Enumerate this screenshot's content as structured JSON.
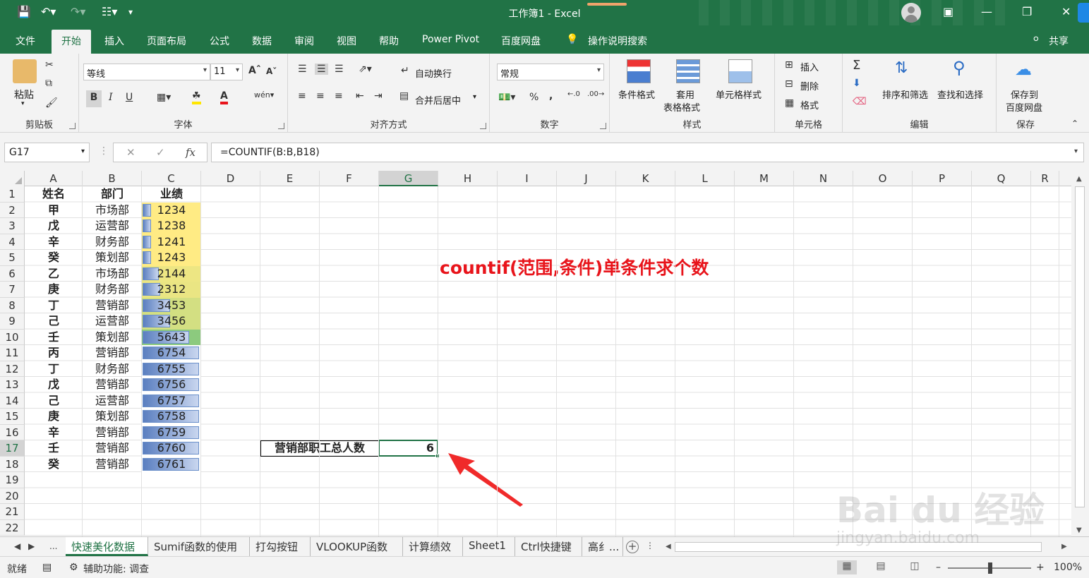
{
  "window": {
    "title": "工作簿1 - Excel",
    "share": "共享"
  },
  "ribbon_tabs": [
    "文件",
    "开始",
    "插入",
    "页面布局",
    "公式",
    "数据",
    "审阅",
    "视图",
    "帮助",
    "Power Pivot",
    "百度网盘",
    "操作说明搜索"
  ],
  "active_tab": "开始",
  "ribbon": {
    "clipboard": {
      "paste": "粘贴",
      "group": "剪贴板"
    },
    "font": {
      "name": "等线",
      "size": "11",
      "bold": "B",
      "italic": "I",
      "underline": "U",
      "group": "字体"
    },
    "alignment": {
      "wrap": "自动换行",
      "merge": "合并后居中",
      "group": "对齐方式"
    },
    "number": {
      "format": "常规",
      "percent": "%",
      "comma": ",",
      "group": "数字"
    },
    "styles": {
      "cond": "条件格式",
      "table1": "套用",
      "table2": "表格格式",
      "cell": "单元格样式",
      "group": "样式"
    },
    "cells": {
      "insert": "插入",
      "delete": "删除",
      "format": "格式",
      "group": "单元格"
    },
    "editing": {
      "sum": "Σ",
      "sort": "排序和筛选",
      "find": "查找和选择",
      "group": "编辑"
    },
    "save": {
      "line1": "保存到",
      "line2": "百度网盘",
      "group": "保存"
    }
  },
  "formula_bar": {
    "cell_ref": "G17",
    "formula": "=COUNTIF(B:B,B18)",
    "fx": "fx"
  },
  "columns": [
    "A",
    "B",
    "C",
    "D",
    "E",
    "F",
    "G",
    "H",
    "I",
    "J",
    "K",
    "L",
    "M",
    "N",
    "O",
    "P",
    "Q",
    "R"
  ],
  "selected_column": "G",
  "selected_row": 17,
  "rows": [
    1,
    2,
    3,
    4,
    5,
    6,
    7,
    8,
    9,
    10,
    11,
    12,
    13,
    14,
    15,
    16,
    17,
    18,
    19,
    20,
    21,
    22
  ],
  "table": {
    "headers": [
      "姓名",
      "部门",
      "业绩"
    ],
    "data": [
      {
        "name": "甲",
        "dept": "市场部",
        "perf": 1234
      },
      {
        "name": "戊",
        "dept": "运营部",
        "perf": 1238
      },
      {
        "name": "辛",
        "dept": "财务部",
        "perf": 1241
      },
      {
        "name": "癸",
        "dept": "策划部",
        "perf": 1243
      },
      {
        "name": "乙",
        "dept": "市场部",
        "perf": 2144
      },
      {
        "name": "庚",
        "dept": "财务部",
        "perf": 2312
      },
      {
        "name": "丁",
        "dept": "营销部",
        "perf": 3453
      },
      {
        "name": "己",
        "dept": "运营部",
        "perf": 3456
      },
      {
        "name": "壬",
        "dept": "策划部",
        "perf": 5643
      },
      {
        "name": "丙",
        "dept": "营销部",
        "perf": 6754
      },
      {
        "name": "丁",
        "dept": "财务部",
        "perf": 6755
      },
      {
        "name": "戊",
        "dept": "营销部",
        "perf": 6756
      },
      {
        "name": "己",
        "dept": "运营部",
        "perf": 6757
      },
      {
        "name": "庚",
        "dept": "策划部",
        "perf": 6758
      },
      {
        "name": "辛",
        "dept": "营销部",
        "perf": 6759
      },
      {
        "name": "壬",
        "dept": "营销部",
        "perf": 6760
      },
      {
        "name": "癸",
        "dept": "营销部",
        "perf": 6761
      }
    ]
  },
  "summary": {
    "label": "营销部职工总人数",
    "value": "6"
  },
  "annotation": "countif(范围,条件)单条件求个数",
  "sheet_tabs": [
    "快速美化数据",
    "Sumif函数的使用",
    "打勾按钮",
    "VLOOKUP函数",
    "计算绩效",
    "Sheet1",
    "Ctrl快捷键",
    "高纟..."
  ],
  "active_sheet": "快速美化数据",
  "status": {
    "ready": "就绪",
    "accessibility": "辅助功能: 调查",
    "zoom": "100%"
  },
  "watermark": {
    "main": "Bai du 经验",
    "sub": "jingyan.baidu.com"
  },
  "colors": {
    "excel_green": "#217346",
    "annotation_red": "#e8141b"
  }
}
